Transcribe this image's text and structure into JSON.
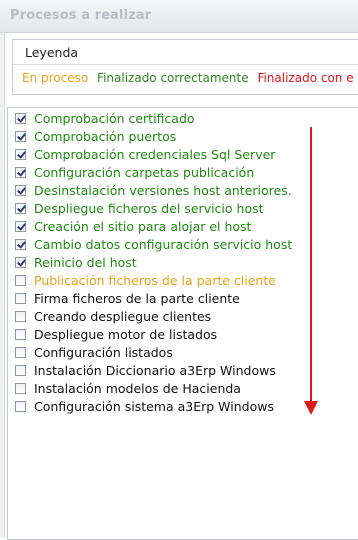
{
  "panel": {
    "title": "Procesos a realizar"
  },
  "legend": {
    "title": "Leyenda",
    "items": [
      {
        "label": "En proceso",
        "color": "#e8a317"
      },
      {
        "label": "Finalizado correctamente",
        "color": "#2e8b1e"
      },
      {
        "label": "Finalizado con e",
        "color": "#e8161a"
      }
    ]
  },
  "tasks": [
    {
      "label": "Comprobación certificado",
      "checked": true,
      "status": "done"
    },
    {
      "label": "Comprobación puertos",
      "checked": true,
      "status": "done"
    },
    {
      "label": "Comprobación credenciales Sql Server",
      "checked": true,
      "status": "done"
    },
    {
      "label": "Configuración carpetas publicación",
      "checked": true,
      "status": "done"
    },
    {
      "label": "Desinstalación versiones host anteriores.",
      "checked": true,
      "status": "done"
    },
    {
      "label": "Despliegue ficheros del servicio host",
      "checked": true,
      "status": "done"
    },
    {
      "label": "Creación el sitio para alojar el host",
      "checked": true,
      "status": "done"
    },
    {
      "label": "Cambio datos configuración servicio host",
      "checked": true,
      "status": "done"
    },
    {
      "label": "Reinicio del host",
      "checked": true,
      "status": "done"
    },
    {
      "label": "Publicación ficheros de la parte cliente",
      "checked": false,
      "status": "in-progress"
    },
    {
      "label": "Firma ficheros de la parte cliente",
      "checked": false,
      "status": "pending"
    },
    {
      "label": "Creando despliegue clientes",
      "checked": false,
      "status": "pending"
    },
    {
      "label": "Despliegue motor de listados",
      "checked": false,
      "status": "pending"
    },
    {
      "label": "Configuración listados",
      "checked": false,
      "status": "pending"
    },
    {
      "label": "Instalación Diccionario a3Erp Windows",
      "checked": false,
      "status": "pending"
    },
    {
      "label": "Instalación modelos de Hacienda",
      "checked": false,
      "status": "pending"
    },
    {
      "label": "Configuración sistema a3Erp Windows",
      "checked": false,
      "status": "pending"
    }
  ],
  "status_colors": {
    "done": "#1f8a12",
    "in-progress": "#e8a317",
    "pending": "#111111"
  },
  "annotation": {
    "icon": "arrow-down-icon",
    "color": "#e01a1a"
  }
}
